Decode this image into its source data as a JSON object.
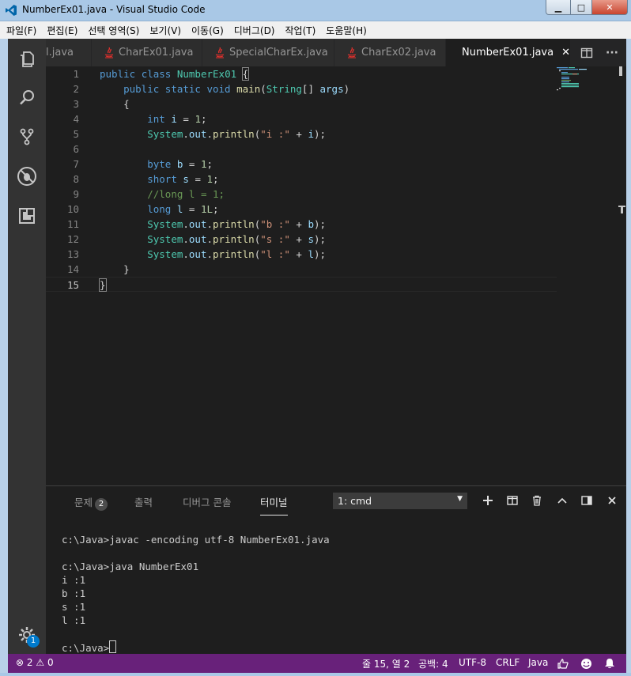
{
  "window": {
    "title": "NumberEx01.java - Visual Studio Code",
    "min_glyph": "▁",
    "max_glyph": "□",
    "close_glyph": "✕"
  },
  "menu": [
    "파일(F)",
    "편집(E)",
    "선택 영역(S)",
    "보기(V)",
    "이동(G)",
    "디버그(D)",
    "작업(T)",
    "도움말(H)"
  ],
  "tabs": [
    {
      "label": "l.java",
      "active": false
    },
    {
      "label": "CharEx01.java",
      "active": false
    },
    {
      "label": "SpecialCharEx.java",
      "active": false
    },
    {
      "label": "CharEx02.java",
      "active": false
    },
    {
      "label": "NumberEx01.java",
      "active": true
    }
  ],
  "tab_close_glyph": "✕",
  "tab_more_glyph": "···",
  "editor": {
    "line_numbers": [
      "1",
      "2",
      "3",
      "4",
      "5",
      "6",
      "7",
      "8",
      "9",
      "10",
      "11",
      "12",
      "13",
      "14",
      "15"
    ],
    "current_line": 15
  },
  "panel": {
    "tabs": {
      "problems": "문제",
      "problems_count": "2",
      "output": "출력",
      "debug_console": "디버그 콘솔",
      "terminal": "터미널"
    },
    "terminal_select": "1: cmd",
    "terminal_lines": [
      "c:\\Java>javac -encoding utf-8 NumberEx01.java",
      "",
      "c:\\Java>java NumberEx01",
      "i :1",
      "b :1",
      "s :1",
      "l :1",
      "",
      "c:\\Java>"
    ]
  },
  "settings_badge": "1",
  "statusbar": {
    "errors": "2",
    "warnings": "0",
    "position": "줄 15, 열 2",
    "indent": "공백: 4",
    "encoding": "UTF-8",
    "eol": "CRLF",
    "language": "Java"
  },
  "colors": {
    "statusbar": "#68217a",
    "editor_bg": "#1e1e1e",
    "activity_bar": "#333333",
    "keyword": "#569cd6",
    "type": "#4ec9b0",
    "string": "#ce9178",
    "number": "#b5cea8",
    "comment": "#6a9955"
  }
}
